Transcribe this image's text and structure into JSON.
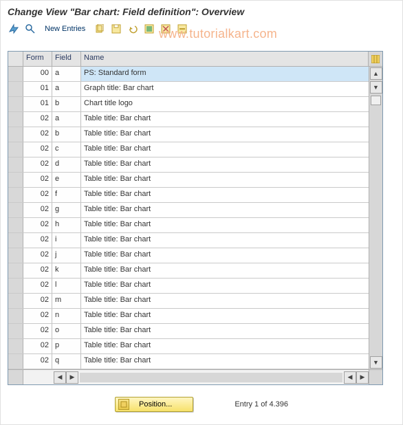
{
  "title": "Change View \"Bar chart: Field definition\": Overview",
  "toolbar": {
    "new_entries": "New Entries"
  },
  "watermark": "www.tutorialkart.com",
  "columns": {
    "form": "Form",
    "field": "Field",
    "name": "Name"
  },
  "rows": [
    {
      "form": "00",
      "field": "a",
      "name": "PS: Standard form",
      "selected": true
    },
    {
      "form": "01",
      "field": "a",
      "name": "Graph title: Bar chart"
    },
    {
      "form": "01",
      "field": "b",
      "name": "Chart title logo"
    },
    {
      "form": "02",
      "field": "a",
      "name": "Table title: Bar chart"
    },
    {
      "form": "02",
      "field": "b",
      "name": "Table title: Bar chart"
    },
    {
      "form": "02",
      "field": "c",
      "name": "Table title: Bar chart"
    },
    {
      "form": "02",
      "field": "d",
      "name": "Table title: Bar chart"
    },
    {
      "form": "02",
      "field": "e",
      "name": "Table title: Bar chart"
    },
    {
      "form": "02",
      "field": "f",
      "name": "Table title: Bar chart"
    },
    {
      "form": "02",
      "field": "g",
      "name": "Table title: Bar chart"
    },
    {
      "form": "02",
      "field": "h",
      "name": "Table title: Bar chart"
    },
    {
      "form": "02",
      "field": "i",
      "name": "Table title: Bar chart"
    },
    {
      "form": "02",
      "field": "j",
      "name": "Table title: Bar chart"
    },
    {
      "form": "02",
      "field": "k",
      "name": "Table title: Bar chart"
    },
    {
      "form": "02",
      "field": "l",
      "name": "Table title: Bar chart"
    },
    {
      "form": "02",
      "field": "m",
      "name": "Table title: Bar chart"
    },
    {
      "form": "02",
      "field": "n",
      "name": "Table title: Bar chart"
    },
    {
      "form": "02",
      "field": "o",
      "name": "Table title: Bar chart"
    },
    {
      "form": "02",
      "field": "p",
      "name": "Table title: Bar chart"
    },
    {
      "form": "02",
      "field": "q",
      "name": "Table title: Bar chart"
    }
  ],
  "footer": {
    "position_label": "Position...",
    "entry_text": "Entry 1 of 4.396"
  }
}
